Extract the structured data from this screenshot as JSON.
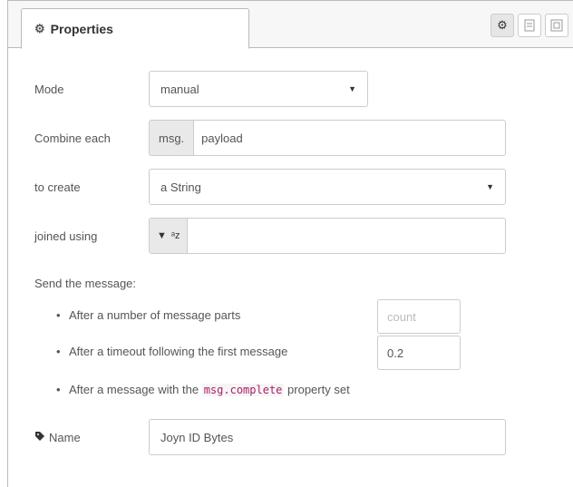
{
  "tab": {
    "title": "Properties",
    "icon": "gear-icon"
  },
  "tab_icons": [
    {
      "name": "settings-gear-icon",
      "glyph": "⚙"
    },
    {
      "name": "description-icon",
      "glyph": "🗎"
    },
    {
      "name": "appearance-icon",
      "glyph": "⊞"
    }
  ],
  "form": {
    "mode": {
      "label": "Mode",
      "value": "manual"
    },
    "combine": {
      "label": "Combine each",
      "prefix": "msg.",
      "value": "payload"
    },
    "create": {
      "label": "to create",
      "value": "a String"
    },
    "joined": {
      "label": "joined using",
      "type_glyph": "ᵃz",
      "value": ""
    },
    "send_title": "Send the message:",
    "parts": {
      "text": "After a number of message parts",
      "placeholder": "count",
      "value": ""
    },
    "timeout": {
      "text": "After a timeout following the first message",
      "value": "0.2"
    },
    "complete": {
      "prefix": "After a message with the",
      "code": "msg.complete",
      "suffix": "property set"
    },
    "name": {
      "label": "Name",
      "value": "Joyn ID Bytes"
    }
  }
}
